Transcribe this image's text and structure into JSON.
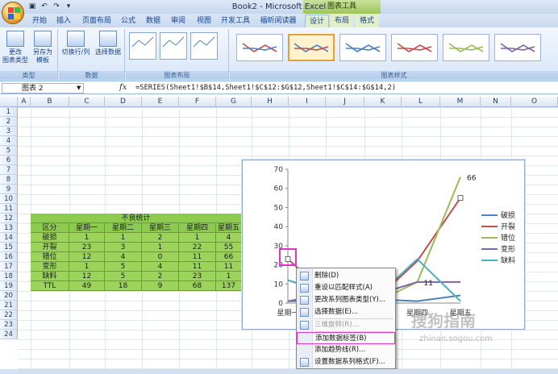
{
  "window": {
    "title": "Book2 - Microsoft Excel",
    "context_group": "图表工具"
  },
  "qat": {
    "save_icon": "save-icon",
    "undo_icon": "undo-icon",
    "redo_icon": "redo-icon"
  },
  "tabs": [
    "开始",
    "插入",
    "页面布局",
    "公式",
    "数据",
    "审阅",
    "视图",
    "开发工具",
    "福昕阅读器",
    "设计",
    "布局",
    "格式"
  ],
  "ribbon": {
    "type_group": {
      "label": "类型",
      "btn1": "更改\n图表类型",
      "btn2": "另存为\n模板"
    },
    "data_group": {
      "label": "数据",
      "btn1": "切换行/列",
      "btn2": "选择数据"
    },
    "layout_group": {
      "label": "图表布局"
    },
    "styles_group": {
      "label": "图表样式"
    }
  },
  "formula_bar": {
    "name_box": "图表 2",
    "fx": "fx",
    "formula": "=SERIES(Sheet1!$B$14,Sheet1!$C$12:$G$12,Sheet1!$C$14:$G$14,2)"
  },
  "columns": [
    "A",
    "B",
    "C",
    "D",
    "E",
    "F",
    "G",
    "H",
    "I",
    "J",
    "K",
    "L",
    "M",
    "N",
    "O"
  ],
  "rows": [
    "1",
    "2",
    "3",
    "4",
    "5",
    "6",
    "7",
    "8",
    "9",
    "10",
    "11",
    "12",
    "13",
    "14",
    "15",
    "16",
    "17",
    "18",
    "19",
    "20",
    "21",
    "22",
    "23",
    "24"
  ],
  "table": {
    "title": "不良统计",
    "header": [
      "区分",
      "星期一",
      "星期二",
      "星期三",
      "星期四",
      "星期五"
    ],
    "rows": [
      [
        "破损",
        "1",
        "1",
        "2",
        "1",
        "4"
      ],
      [
        "开裂",
        "23",
        "3",
        "1",
        "22",
        "55"
      ],
      [
        "错位",
        "12",
        "4",
        "0",
        "11",
        "66"
      ],
      [
        "变形",
        "1",
        "5",
        "4",
        "11",
        "11"
      ],
      [
        "缺料",
        "12",
        "5",
        "2",
        "23",
        "1"
      ],
      [
        "TTL",
        "49",
        "18",
        "9",
        "68",
        "137"
      ]
    ]
  },
  "chart_data": {
    "type": "line",
    "categories": [
      "星期一",
      "星期二",
      "星期三",
      "星期四",
      "星期五"
    ],
    "category_labels_visible": [
      "星期一",
      "星期四",
      "星期五"
    ],
    "ylim": [
      0,
      70
    ],
    "yticks": [
      0,
      10,
      20,
      30,
      40,
      50,
      60,
      70
    ],
    "grid": false,
    "legend": "right",
    "series": [
      {
        "name": "破损",
        "values": [
          1,
          1,
          2,
          1,
          4
        ],
        "color": "#4f81bd"
      },
      {
        "name": "开裂",
        "values": [
          23,
          3,
          1,
          22,
          55
        ],
        "color": "#c0504d"
      },
      {
        "name": "错位",
        "values": [
          12,
          4,
          0,
          11,
          66
        ],
        "color": "#9bbb59"
      },
      {
        "name": "变形",
        "values": [
          1,
          5,
          4,
          11,
          11
        ],
        "color": "#8064a2"
      },
      {
        "name": "缺料",
        "values": [
          12,
          5,
          2,
          23,
          1
        ],
        "color": "#4bacc6"
      }
    ],
    "data_labels": [
      {
        "text": "66"
      },
      {
        "text": "11"
      }
    ]
  },
  "context_menu": [
    {
      "label": "删除(D)",
      "enabled": true,
      "icon": "delete-icon"
    },
    {
      "label": "重设以匹配样式(A)",
      "enabled": true,
      "icon": "reset-style-icon"
    },
    {
      "label": "更改系列图表类型(Y)...",
      "enabled": true,
      "icon": "chart-type-icon"
    },
    {
      "label": "选择数据(E)...",
      "enabled": true,
      "icon": "select-data-icon"
    },
    {
      "label": "三维旋转(R)...",
      "enabled": false,
      "icon": "rotate-3d-icon"
    },
    {
      "label": "添加数据标签(B)",
      "enabled": true,
      "icon": "",
      "highlighted": true
    },
    {
      "label": "添加趋势线(R)...",
      "enabled": true,
      "icon": ""
    },
    {
      "label": "设置数据系列格式(F)...",
      "enabled": true,
      "icon": "format-series-icon"
    }
  ],
  "watermark": {
    "text": "搜狗指南",
    "url": "zhinan.sogou.com"
  }
}
